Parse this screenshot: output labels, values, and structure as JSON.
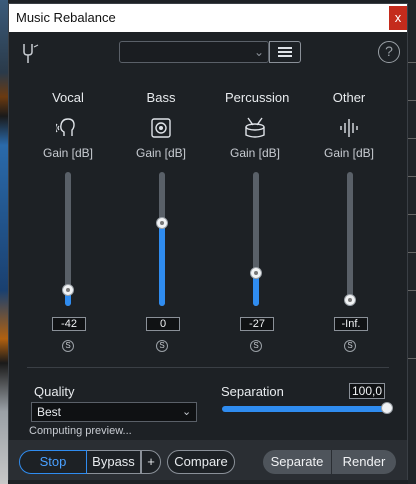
{
  "window": {
    "title": "Music Rebalance",
    "close_label": "x"
  },
  "toolbar": {
    "preset_value": "",
    "icons": {
      "plugin": "tuning-fork-icon",
      "menu": "hamburger-icon",
      "help": "help-icon"
    },
    "help_label": "?"
  },
  "channels": [
    {
      "name": "Vocal",
      "icon": "voice-head-icon",
      "gain_label": "Gain [dB]",
      "value": "-42",
      "level_fraction": 0.08,
      "solo": "S"
    },
    {
      "name": "Bass",
      "icon": "speaker-icon",
      "gain_label": "Gain [dB]",
      "value": "0",
      "level_fraction": 0.63,
      "solo": "S"
    },
    {
      "name": "Percussion",
      "icon": "drum-icon",
      "gain_label": "Gain [dB]",
      "value": "-27",
      "level_fraction": 0.22,
      "solo": "S"
    },
    {
      "name": "Other",
      "icon": "waveform-icon",
      "gain_label": "Gain [dB]",
      "value": "-Inf.",
      "level_fraction": 0.0,
      "solo": "S"
    }
  ],
  "quality": {
    "label": "Quality",
    "selected": "Best"
  },
  "separation": {
    "label": "Separation",
    "value": "100,0",
    "level_fraction": 1.0
  },
  "status": "Computing preview...",
  "footer": {
    "stop": "Stop",
    "bypass": "Bypass",
    "plus": "+",
    "compare": "Compare",
    "separate": "Separate",
    "render": "Render"
  },
  "colors": {
    "accent": "#2f8cf0",
    "background": "#1d2125",
    "close": "#c42b1c"
  }
}
